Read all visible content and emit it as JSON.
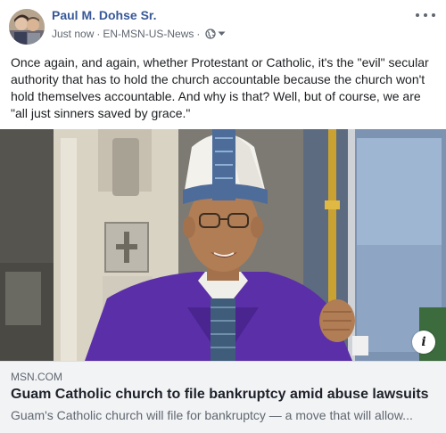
{
  "post": {
    "author": "Paul M. Dohse Sr.",
    "timestamp": "Just now",
    "separator": "·",
    "source": "EN-MSN-US-News",
    "privacy_icon": "globe-icon",
    "audience_icon": "caret-down-icon",
    "more_icon": "more-options-icon",
    "text": "Once again, and again, whether Protestant or Catholic, it's the \"evil\" secular authority that has to hold the church accountable because the church won't hold themselves accountable. And why is that? Well, but of course, we are \"all just sinners saved by grace.\""
  },
  "link_preview": {
    "domain": "MSN.COM",
    "title": "Guam Catholic church to file bankruptcy amid abuse lawsuits",
    "description": "Guam's Catholic church will file for bankruptcy — a move that will allow...",
    "info_icon_label": "i"
  },
  "colors": {
    "author": "#385898",
    "meta": "#606770",
    "text": "#1c1e21",
    "preview_bg": "#f2f3f5",
    "vestment_purple": "#5b2fa8"
  }
}
